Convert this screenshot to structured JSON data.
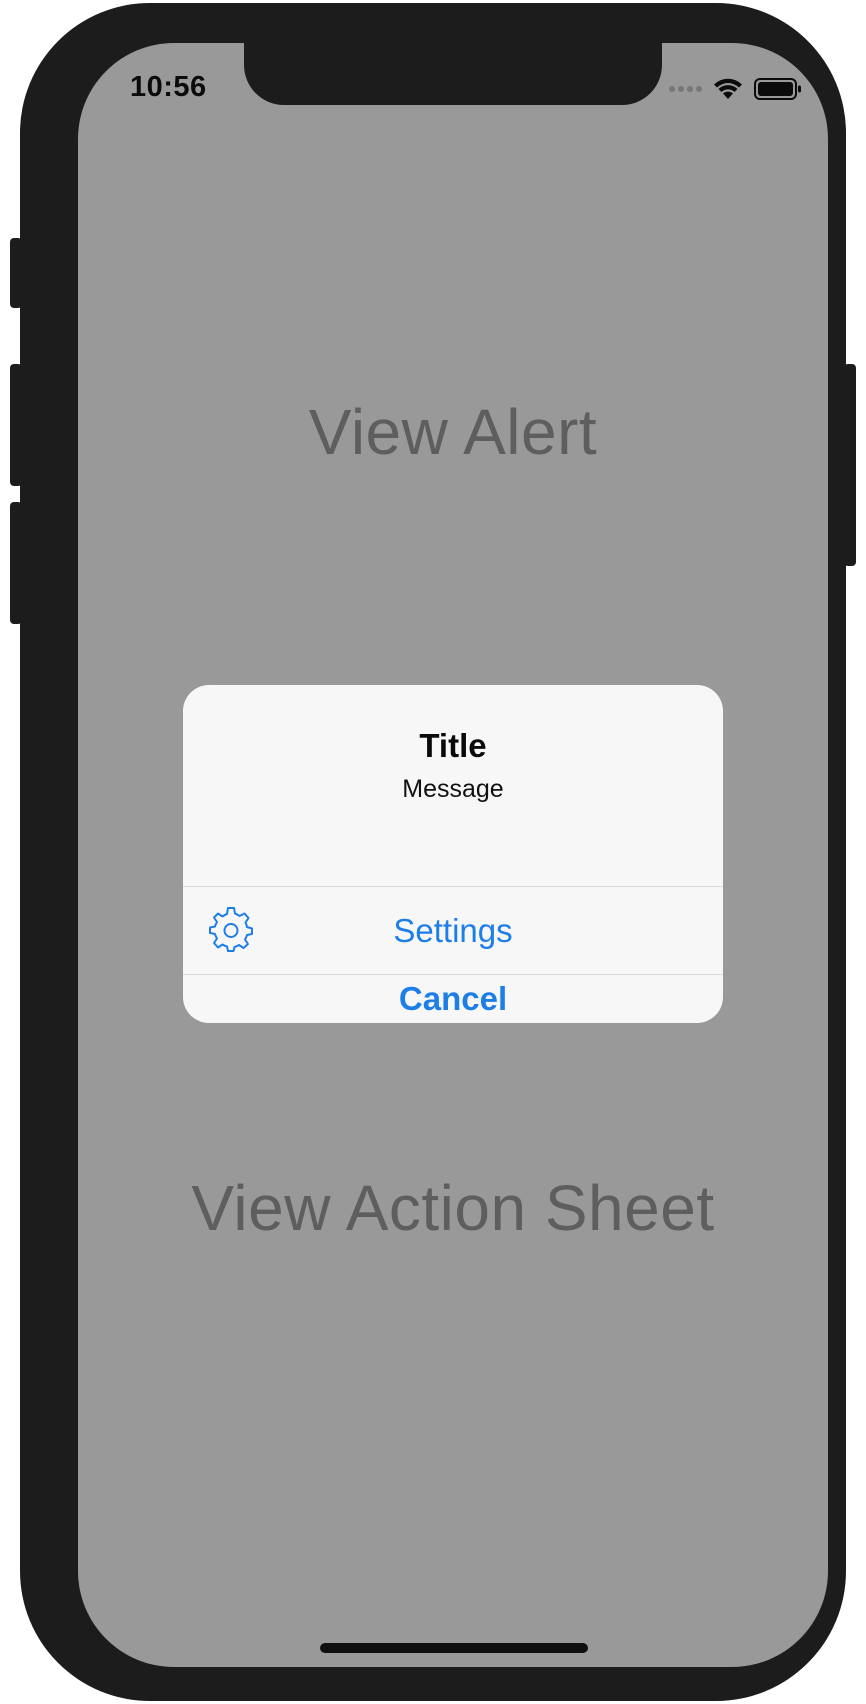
{
  "status_bar": {
    "time": "10:56",
    "signal_icon": "cellular-signal-dots",
    "wifi_icon": "wifi",
    "battery_icon": "battery-full"
  },
  "main": {
    "view_alert_label": "View Alert",
    "view_action_sheet_label": "View Action Sheet"
  },
  "alert": {
    "title": "Title",
    "message": "Message",
    "actions": [
      {
        "label": "Settings",
        "icon": "gear-icon",
        "style": "default"
      },
      {
        "label": "Cancel",
        "style": "cancel"
      }
    ]
  },
  "colors": {
    "background": "#999999",
    "device_frame": "#1c1c1c",
    "alert_background": "#f7f7f7",
    "action_tint": "#1e7ee8",
    "link_text": "#5e5e5e"
  }
}
